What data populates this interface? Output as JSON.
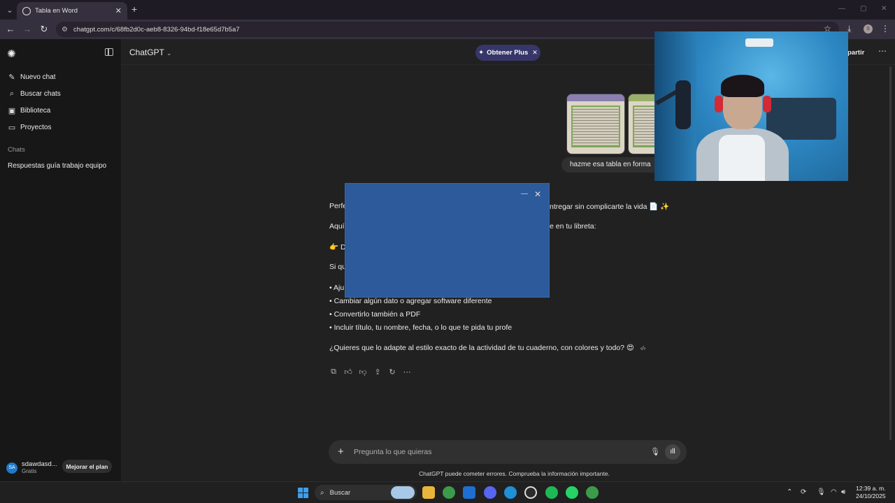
{
  "browser": {
    "tab_title": "Tabla en Word",
    "new_tab": "+",
    "url": "chatgpt.com/c/68fb2d0c-aeb8-8326-94bd-f18e65d7b5a7",
    "profile_initial": "S"
  },
  "sidebar": {
    "items": [
      {
        "label": "Nuevo chat",
        "icon": "edit-icon"
      },
      {
        "label": "Buscar chats",
        "icon": "search-icon"
      },
      {
        "label": "Biblioteca",
        "icon": "library-icon"
      },
      {
        "label": "Proyectos",
        "icon": "folder-icon"
      }
    ],
    "chats_label": "Chats",
    "chats": [
      "Respuestas guía trabajo equipo"
    ],
    "user": {
      "initials": "SA",
      "name": "sdawdasd...",
      "plan": "Gratis"
    },
    "upgrade_label": "Mejorar el plan"
  },
  "header": {
    "model": "ChatGPT",
    "plus_label": "Obtener Plus",
    "share_label": "partir"
  },
  "conversation": {
    "user_message": "hazme esa tabla en forma",
    "assistant": {
      "line1_start": "Perfe",
      "line1_end": "ntregar sin complicarte la vida 📄 ✨",
      "line2_start": "Aquí",
      "line2_end": "e en tu libreta:",
      "line3": "👉 D",
      "line4": "Si qu",
      "bullets": [
        "• Aju",
        "• Cambiar algún dato o agregar software diferente",
        "• Convertirlo también a PDF",
        "• Incluir título, tu nombre, fecha, o lo que te pida tu profe"
      ],
      "closing": "¿Quieres que lo adapte al estilo exacto de la actividad de tu cuaderno, con colores y todo? 😍"
    }
  },
  "composer": {
    "placeholder": "Pregunta lo que quieras",
    "disclaimer": "ChatGPT puede cometer errores. Comprueba la información importante."
  },
  "taskbar": {
    "search_label": "Buscar",
    "time": "12:39 a. m.",
    "date": "24/10/2025"
  },
  "colors": {
    "background": "#212121",
    "sidebar": "#171717",
    "plus_button": "#373669",
    "popup": "#2d5a9b"
  }
}
